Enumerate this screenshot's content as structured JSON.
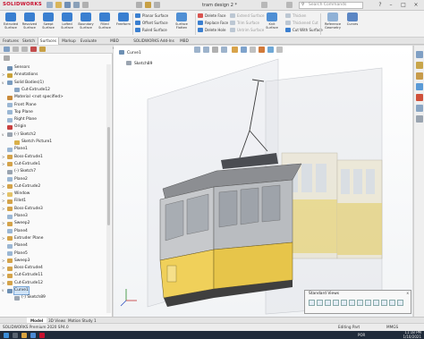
{
  "app": {
    "logo_brand": "SOLIDWORKS",
    "document_title": "tram design 2 *",
    "search_placeholder": "Search Commands"
  },
  "command_manager": {
    "big_tools": [
      {
        "label": "Extruded Surface",
        "color": "#3a7fd0"
      },
      {
        "label": "Revolved Surface",
        "color": "#3a7fd0"
      },
      {
        "label": "Swept Surface",
        "color": "#3a7fd0"
      },
      {
        "label": "Lofted Surface",
        "color": "#3a7fd0"
      },
      {
        "label": "Boundary Surface",
        "color": "#3a7fd0"
      },
      {
        "label": "Filled Surface",
        "color": "#3a7fd0"
      },
      {
        "label": "Freeform",
        "color": "#3a7fd0"
      }
    ],
    "small_tools_col1": [
      "Planar Surface",
      "Offset Surface",
      "Ruled Surface"
    ],
    "surface_flatten": "Surface Flatten",
    "small_tools_col2": [
      "Delete Face",
      "Replace Face",
      "Delete Hole"
    ],
    "gray_tools": [
      "Extend Surface",
      "Trim Surface",
      "Untrim Surface"
    ],
    "knit_surface": "Knit Surface",
    "small_tools_col3": [
      "Thicken",
      "Thickened Cut",
      "Cut With Surface"
    ],
    "reference_geometry": "Reference Geometry",
    "curves": "Curves"
  },
  "tabs": [
    "Features",
    "Sketch",
    "Surfaces",
    "Markup",
    "Evaluate",
    "MBD Dimensions",
    "SOLIDWORKS Add-Ins",
    "MBD"
  ],
  "active_tab": "Surfaces",
  "graphics": {
    "flyout_title": "Curve1",
    "flyout_sub": "Sketch89"
  },
  "tree": [
    {
      "label": "Sensors",
      "icon": "sensor-icon",
      "color": "#6d8fb3",
      "indent": 1,
      "exp": ""
    },
    {
      "label": "Annotations",
      "icon": "annotation-icon",
      "color": "#c9a23a",
      "indent": 1,
      "exp": ">"
    },
    {
      "label": "Solid Bodies(1)",
      "icon": "solid-bodies-icon",
      "color": "#7a9cc0",
      "indent": 1,
      "exp": "v"
    },
    {
      "label": "Cut-Extrude12",
      "icon": "body-icon",
      "color": "#8aa6c4",
      "indent": 2,
      "exp": ""
    },
    {
      "label": "Material <not specified>",
      "icon": "material-icon",
      "color": "#c98a3a",
      "indent": 1,
      "exp": ""
    },
    {
      "label": "Front Plane",
      "icon": "plane-icon",
      "color": "#9bb7d4",
      "indent": 1,
      "exp": ""
    },
    {
      "label": "Top Plane",
      "icon": "plane-icon",
      "color": "#9bb7d4",
      "indent": 1,
      "exp": ""
    },
    {
      "label": "Right Plane",
      "icon": "plane-icon",
      "color": "#9bb7d4",
      "indent": 1,
      "exp": ""
    },
    {
      "label": "Origin",
      "icon": "origin-icon",
      "color": "#c94040",
      "indent": 1,
      "exp": ""
    },
    {
      "label": "(-) Sketch2",
      "icon": "sketch-icon",
      "color": "#9aa4b0",
      "indent": 1,
      "exp": "v"
    },
    {
      "label": "Sketch Picture1",
      "icon": "picture-icon",
      "color": "#d9b04a",
      "indent": 2,
      "exp": ""
    },
    {
      "label": "Plane1",
      "icon": "plane-icon",
      "color": "#9bb7d4",
      "indent": 1,
      "exp": ""
    },
    {
      "label": "Boss-Extrude1",
      "icon": "extrude-icon",
      "color": "#d4a34a",
      "indent": 1,
      "exp": ">"
    },
    {
      "label": "Cut-Extrude1",
      "icon": "cut-icon",
      "color": "#d4a34a",
      "indent": 1,
      "exp": ">"
    },
    {
      "label": "(-) Sketch7",
      "icon": "sketch-icon",
      "color": "#9aa4b0",
      "indent": 1,
      "exp": ""
    },
    {
      "label": "Plane2",
      "icon": "plane-icon",
      "color": "#9bb7d4",
      "indent": 1,
      "exp": ""
    },
    {
      "label": "Cut-Extrude2",
      "icon": "cut-icon",
      "color": "#d4a34a",
      "indent": 1,
      "exp": ">"
    },
    {
      "label": "Window",
      "icon": "folder-icon",
      "color": "#e3c268",
      "indent": 1,
      "exp": ">"
    },
    {
      "label": "Fillet1",
      "icon": "fillet-icon",
      "color": "#d4a34a",
      "indent": 1,
      "exp": ">"
    },
    {
      "label": "Boss-Extrude3",
      "icon": "extrude-icon",
      "color": "#d4a34a",
      "indent": 1,
      "exp": ">"
    },
    {
      "label": "Plane3",
      "icon": "plane-icon",
      "color": "#9bb7d4",
      "indent": 1,
      "exp": ""
    },
    {
      "label": "Sweep2",
      "icon": "sweep-icon",
      "color": "#d4a34a",
      "indent": 1,
      "exp": ">"
    },
    {
      "label": "Plane4",
      "icon": "plane-icon",
      "color": "#9bb7d4",
      "indent": 1,
      "exp": ""
    },
    {
      "label": "Extruder Plane",
      "icon": "extrude-icon",
      "color": "#d4a34a",
      "indent": 1,
      "exp": ">"
    },
    {
      "label": "Plane4",
      "icon": "plane-icon",
      "color": "#9bb7d4",
      "indent": 1,
      "exp": ""
    },
    {
      "label": "Plane5",
      "icon": "plane-icon",
      "color": "#9bb7d4",
      "indent": 1,
      "exp": ""
    },
    {
      "label": "Sweep3",
      "icon": "sweep-icon",
      "color": "#d4a34a",
      "indent": 1,
      "exp": ">"
    },
    {
      "label": "Boss-Extrude4",
      "icon": "extrude-icon",
      "color": "#d4a34a",
      "indent": 1,
      "exp": ">"
    },
    {
      "label": "Cut-Extrude11",
      "icon": "cut-icon",
      "color": "#d4a34a",
      "indent": 1,
      "exp": ">"
    },
    {
      "label": "Cut-Extrude12",
      "icon": "cut-icon",
      "color": "#d4a34a",
      "indent": 1,
      "exp": ">"
    },
    {
      "label": "Curve1",
      "icon": "curve-icon",
      "color": "#6d8fb3",
      "indent": 1,
      "exp": "v",
      "selected": true
    },
    {
      "label": "(-) Sketch89",
      "icon": "sketch-icon",
      "color": "#9aa4b0",
      "indent": 2,
      "exp": ""
    }
  ],
  "model_tabs": [
    "Model",
    "3D Views",
    "Motion Study 1"
  ],
  "active_model_tab": "Model",
  "status": {
    "left": "SOLIDWORKS Premium 2020 SP4.0",
    "right_state": "Editing Part",
    "units": "MMGS",
    "clock_time": "11:18 PM",
    "clock_date": "1/10/2021",
    "lang": "POR"
  },
  "standard_views": {
    "title": "Standard Views",
    "close": "x"
  }
}
